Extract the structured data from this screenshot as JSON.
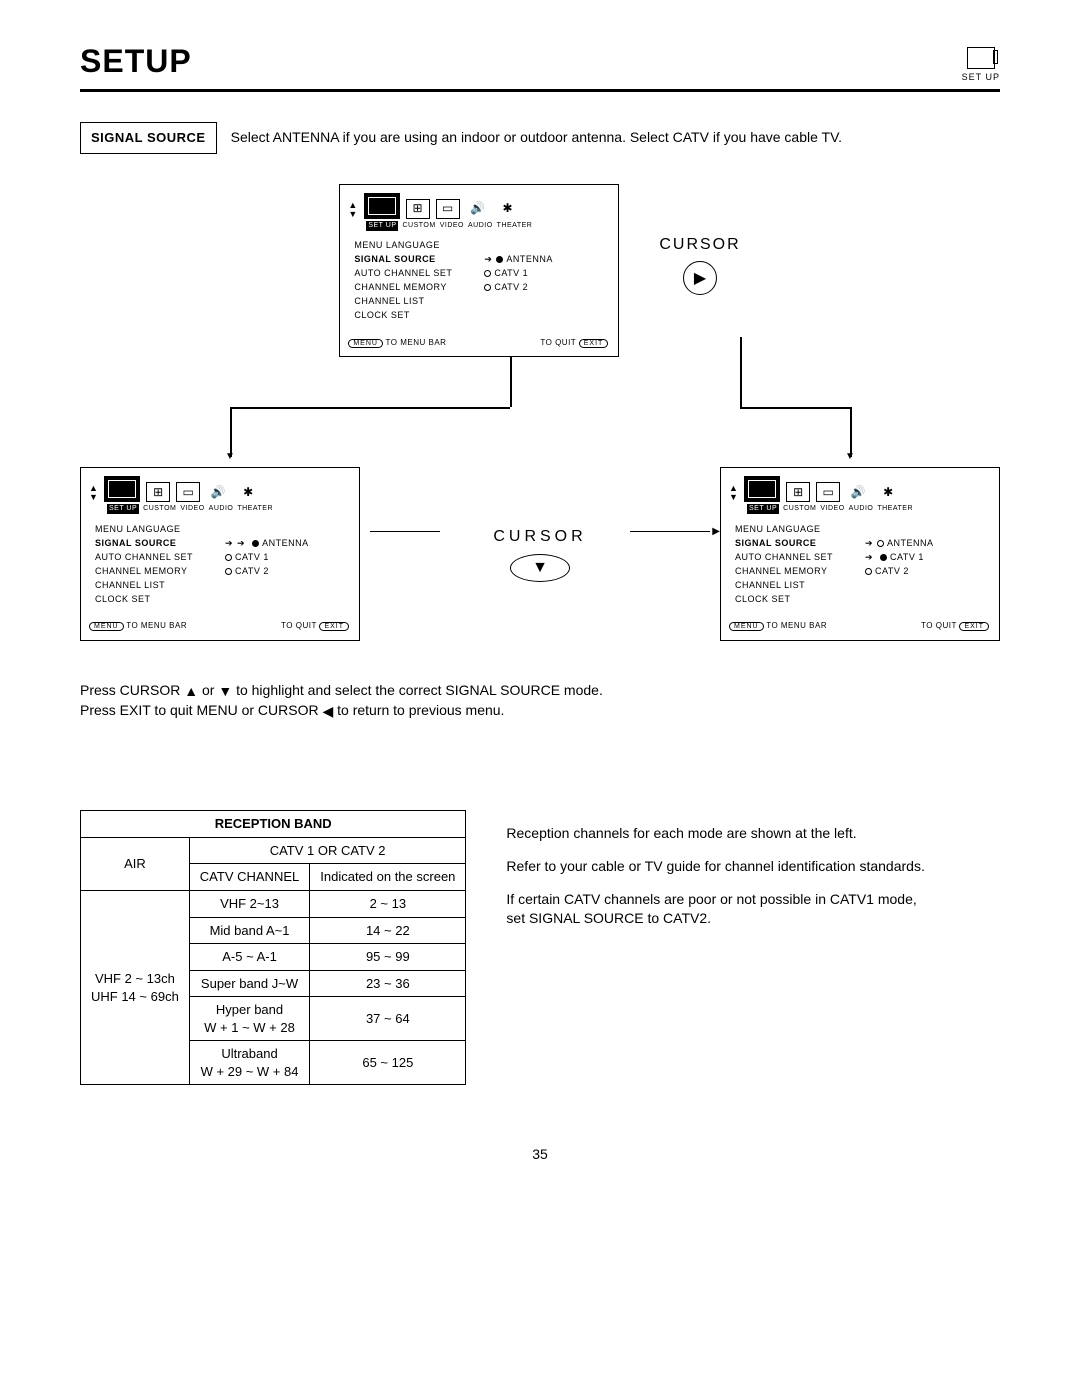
{
  "header": {
    "title": "SETUP",
    "icon_label": "SET UP"
  },
  "signal_source": {
    "label": "SIGNAL SOURCE",
    "text": "Select ANTENNA if you are using an indoor or outdoor antenna.  Select CATV if you have cable TV."
  },
  "cursor": {
    "label": "CURSOR"
  },
  "menu": {
    "tabs": [
      "SET UP",
      "CUSTOM",
      "VIDEO",
      "AUDIO",
      "THEATER"
    ],
    "items": [
      "MENU LANGUAGE",
      "SIGNAL SOURCE",
      "AUTO CHANNEL SET",
      "CHANNEL MEMORY",
      "CHANNEL LIST",
      "CLOCK SET"
    ],
    "options": [
      "ANTENNA",
      "CATV 1",
      "CATV 2"
    ],
    "footer": {
      "menu_btn": "MENU",
      "menu_txt": "TO MENU BAR",
      "quit_txt": "TO QUIT",
      "exit_btn": "EXIT"
    }
  },
  "menu_variants": [
    {
      "selected_option_index": 0,
      "arrow_on_option": false
    },
    {
      "selected_option_index": 0,
      "arrow_on_option": true
    },
    {
      "selected_option_index": 1,
      "arrow_on_option": true
    }
  ],
  "instructions": {
    "line1_a": "Press CURSOR ",
    "line1_b": " or ",
    "line1_c": " to highlight and select the correct SIGNAL SOURCE mode.",
    "line2_a": "Press EXIT to quit MENU or CURSOR ",
    "line2_b": " to return to previous menu."
  },
  "chart_data": {
    "type": "table",
    "title": "RECEPTION BAND",
    "subheader": "CATV 1 OR CATV 2",
    "columns": [
      "AIR",
      "CATV CHANNEL",
      "Indicated on the screen"
    ],
    "air_rows": [
      "VHF 2 ~ 13ch",
      "UHF 14 ~ 69ch"
    ],
    "rows": [
      {
        "catv": "VHF 2~13",
        "screen": "2 ~ 13"
      },
      {
        "catv": "Mid band A~1",
        "screen": "14 ~ 22"
      },
      {
        "catv": "A-5 ~ A-1",
        "screen": "95 ~ 99"
      },
      {
        "catv": "Super band J~W",
        "screen": "23 ~ 36"
      },
      {
        "catv": "Hyper band\nW + 1 ~ W + 28",
        "screen": "37 ~ 64"
      },
      {
        "catv": "Ultraband\nW + 29 ~ W + 84",
        "screen": "65 ~ 125"
      }
    ]
  },
  "side_notes": {
    "p1": "Reception channels for each mode are shown at the left.",
    "p2": "Refer to your cable or TV guide for channel identification standards.",
    "p3": "If certain CATV channels are poor or not possible in CATV1 mode, set SIGNAL SOURCE to CATV2."
  },
  "page_number": "35"
}
